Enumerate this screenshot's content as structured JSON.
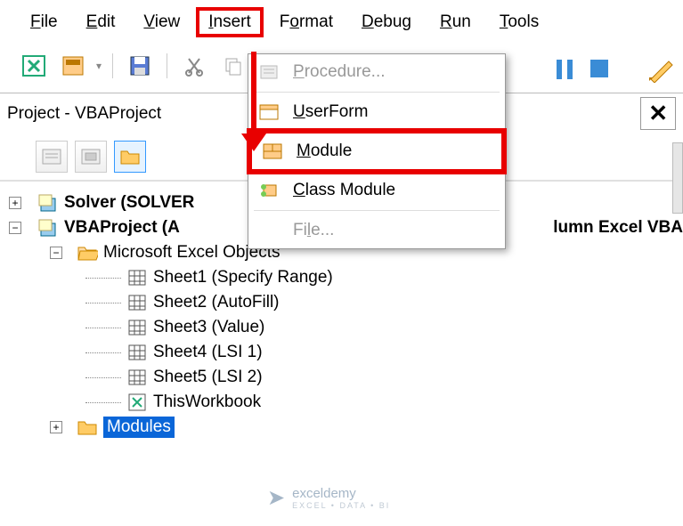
{
  "menu": {
    "file": "File",
    "edit": "Edit",
    "view": "View",
    "insert": "Insert",
    "format": "Format",
    "debug": "Debug",
    "run": "Run",
    "tools": "Tools"
  },
  "project_pane_title": "Project - VBAProject",
  "dropdown": {
    "procedure": "Procedure...",
    "userform": "UserForm",
    "module": "Module",
    "class_module": "Class Module",
    "file": "File..."
  },
  "tree": {
    "solver": "Solver (SOLVER",
    "project": "VBAProject (A",
    "project_suffix": "lumn Excel VBA",
    "excel_objects": "Microsoft Excel Objects",
    "sheet1": "Sheet1 (Specify Range)",
    "sheet2": "Sheet2 (AutoFill)",
    "sheet3": "Sheet3 (Value)",
    "sheet4": "Sheet4 (LSI 1)",
    "sheet5": "Sheet5 (LSI 2)",
    "thisworkbook": "ThisWorkbook",
    "modules": "Modules"
  },
  "watermark": {
    "name": "exceldemy",
    "sub": "EXCEL • DATA • BI"
  }
}
